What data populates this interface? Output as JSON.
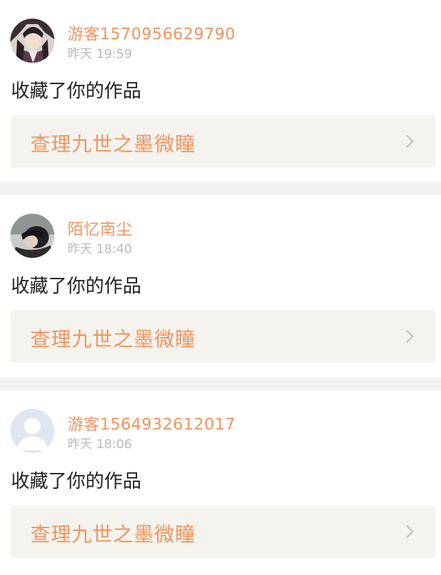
{
  "notifications": [
    {
      "username": "游客1570956629790",
      "time": "昨天 19:59",
      "action": "收藏了你的作品",
      "work_title": "查理九世之墨微瞳",
      "avatar_icon": "anime-character-avatar-icon"
    },
    {
      "username": "陌忆南尘",
      "time": "昨天 18:40",
      "action": "收藏了你的作品",
      "work_title": "查理九世之墨微瞳",
      "avatar_icon": "photo-avatar-icon"
    },
    {
      "username": "游客1564932612017",
      "time": "昨天 18:06",
      "action": "收藏了你的作品",
      "work_title": "查理九世之墨微瞳",
      "avatar_icon": "default-user-avatar-icon"
    }
  ],
  "colors": {
    "accent": "#f0955f",
    "background": "#f2f2f2",
    "link_background": "#f4f3ee",
    "time_text": "#b9b9b9",
    "body_text": "#222222"
  }
}
